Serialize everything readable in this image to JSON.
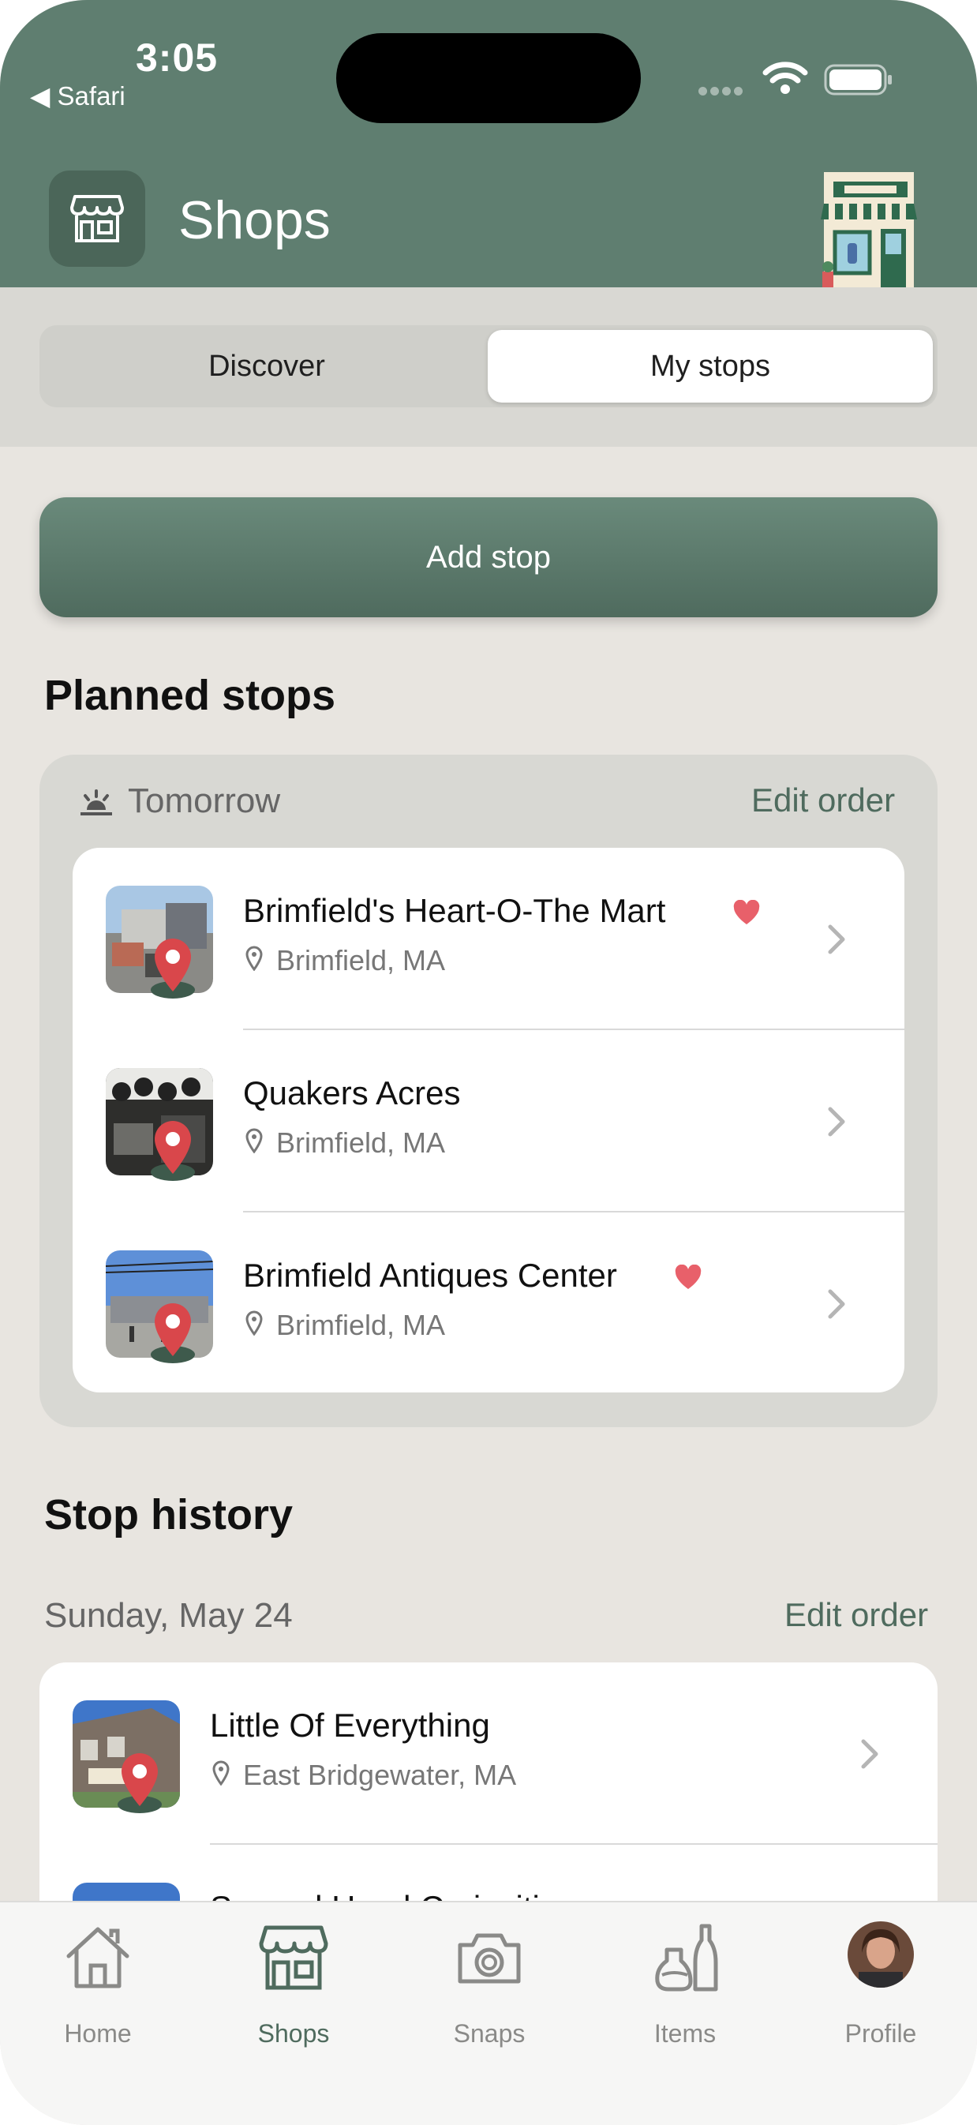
{
  "status_bar": {
    "time": "3:05",
    "back_label": "◀ Safari"
  },
  "header": {
    "title": "Shops",
    "icon": "storefront-icon"
  },
  "segmented": {
    "discover": "Discover",
    "my_stops": "My stops",
    "selected": "My stops"
  },
  "add_stop_label": "Add stop",
  "planned": {
    "title": "Planned stops",
    "day": "Tomorrow",
    "edit_order": "Edit order",
    "items": [
      {
        "name": "Brimfield's Heart-O-The Mart",
        "location": "Brimfield, MA",
        "favorite": true
      },
      {
        "name": "Quakers Acres",
        "location": "Brimfield, MA",
        "favorite": false
      },
      {
        "name": "Brimfield Antiques Center",
        "location": "Brimfield, MA",
        "favorite": true
      }
    ]
  },
  "history": {
    "title": "Stop history",
    "day": "Sunday, May 24",
    "edit_order": "Edit order",
    "items": [
      {
        "name": "Little Of Everything",
        "location": "East Bridgewater, MA"
      },
      {
        "name": "Second Hand Curiosities"
      }
    ]
  },
  "tabs": [
    {
      "label": "Home",
      "icon": "house-icon"
    },
    {
      "label": "Shops",
      "icon": "storefront-icon",
      "active": true
    },
    {
      "label": "Snaps",
      "icon": "camera-icon"
    },
    {
      "label": "Items",
      "icon": "vases-icon"
    },
    {
      "label": "Profile",
      "icon": "avatar"
    }
  ],
  "colors": {
    "accent": "#5f7e70",
    "heart": "#e8606a",
    "pin": "#d9474b"
  }
}
